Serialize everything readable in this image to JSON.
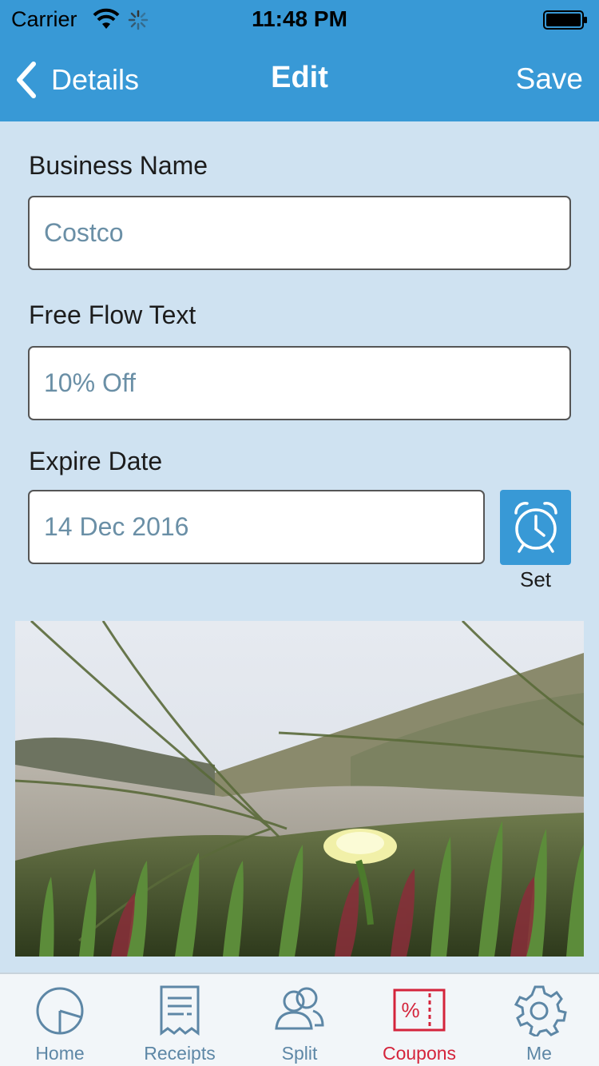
{
  "status_bar": {
    "carrier": "Carrier",
    "time": "11:48 PM"
  },
  "nav": {
    "back_label": "Details",
    "title": "Edit",
    "save_label": "Save"
  },
  "form": {
    "business_name": {
      "label": "Business Name",
      "value": "Costco"
    },
    "free_flow_text": {
      "label": "Free Flow Text",
      "value": "10% Off"
    },
    "expire_date": {
      "label": "Expire Date",
      "value": "14 Dec 2016"
    },
    "set_label": "Set"
  },
  "photo": {
    "icon": "coupon-photo"
  },
  "tabs": [
    {
      "label": "Home",
      "icon": "pie-chart-icon",
      "active": false
    },
    {
      "label": "Receipts",
      "icon": "receipt-icon",
      "active": false
    },
    {
      "label": "Split",
      "icon": "users-icon",
      "active": false
    },
    {
      "label": "Coupons",
      "icon": "coupon-icon",
      "active": true
    },
    {
      "label": "Me",
      "icon": "gear-icon",
      "active": false
    }
  ],
  "colors": {
    "nav_blue": "#3899d6",
    "background": "#cfe2f1",
    "tab_inactive": "#5d87a6",
    "tab_active": "#d4243b"
  }
}
